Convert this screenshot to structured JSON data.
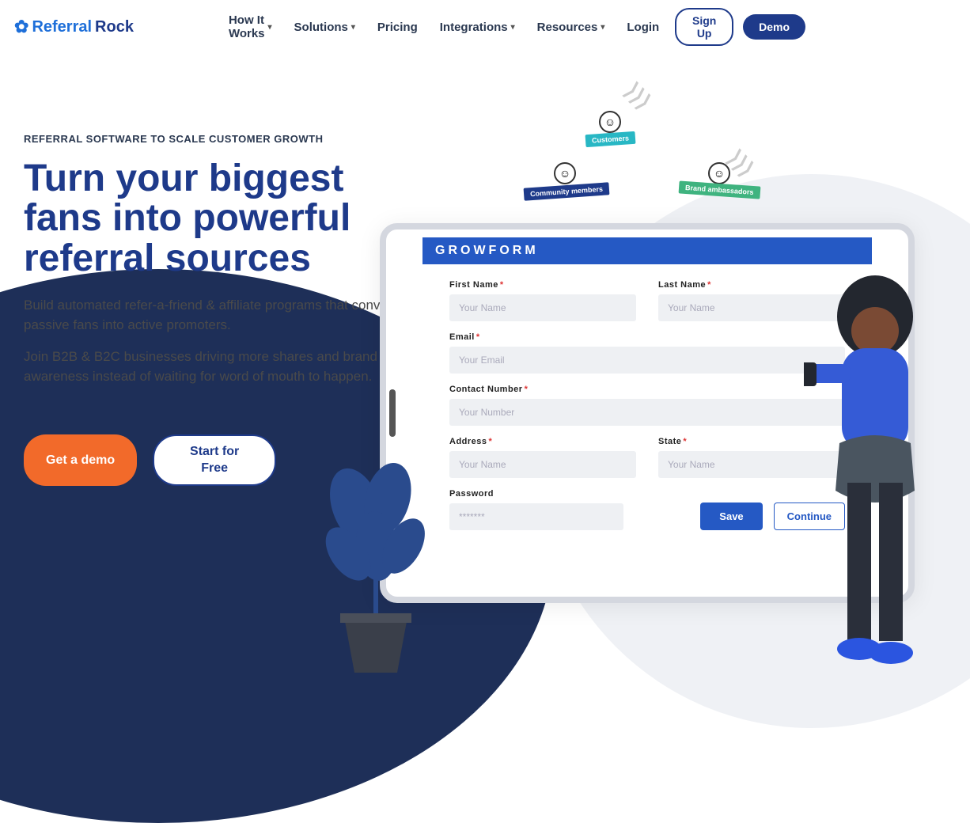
{
  "brand": {
    "referral": "Referral",
    "rock": "Rock"
  },
  "nav": {
    "items": [
      {
        "label": "How It Works",
        "dropdown": true
      },
      {
        "label": "Solutions",
        "dropdown": true
      },
      {
        "label": "Pricing",
        "dropdown": false
      },
      {
        "label": "Integrations",
        "dropdown": true
      },
      {
        "label": "Resources",
        "dropdown": true
      }
    ],
    "login": "Login",
    "signup": "Sign Up",
    "demo": "Demo"
  },
  "hero": {
    "eyebrow": "REFERRAL SOFTWARE TO SCALE CUSTOMER GROWTH",
    "headline": "Turn your biggest fans into powerful referral sources",
    "p1": "Build automated refer-a-friend & affiliate programs that convert passive fans into active promoters.",
    "p2": "Join B2B & B2C businesses driving more shares and brand awareness instead of waiting for word of mouth to happen.",
    "cta_demo": "Get a demo",
    "cta_free": "Start for Free"
  },
  "network": {
    "customers": "Customers",
    "community": "Community members",
    "ambassadors": "Brand ambassadors"
  },
  "form": {
    "header": "GROWFORM",
    "first_name": {
      "label": "First Name",
      "placeholder": "Your Name"
    },
    "last_name": {
      "label": "Last Name",
      "placeholder": "Your Name"
    },
    "email": {
      "label": "Email",
      "placeholder": "Your Email"
    },
    "contact": {
      "label": "Contact Number",
      "placeholder": "Your Number"
    },
    "address": {
      "label": "Address",
      "placeholder": "Your Name"
    },
    "state": {
      "label": "State",
      "placeholder": "Your Name"
    },
    "password": {
      "label": "Password",
      "placeholder": "*******"
    },
    "save": "Save",
    "continue": "Continue"
  }
}
